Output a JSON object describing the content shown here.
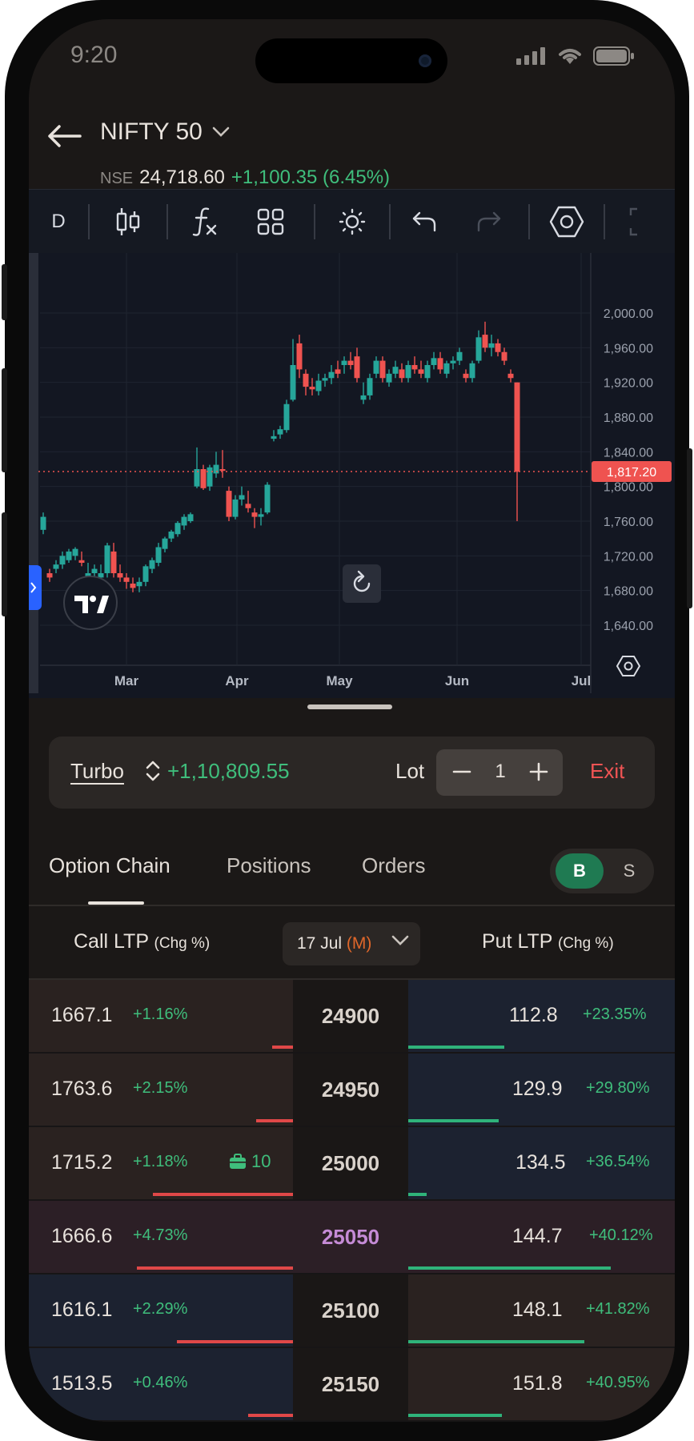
{
  "status": {
    "time": "9:20"
  },
  "header": {
    "title": "NIFTY 50",
    "exchange": "NSE",
    "price": "24,718.60",
    "change": "+1,100.35 (6.45%)"
  },
  "toolbar": {
    "interval": "D"
  },
  "chart_data": {
    "type": "candlestick",
    "x_labels": [
      "Mar",
      "Apr",
      "May",
      "Jun",
      "Jul"
    ],
    "y_labels": [
      "2,000.00",
      "1,960.00",
      "1,920.00",
      "1,880.00",
      "1,840.00",
      "1,800.00",
      "1,760.00",
      "1,720.00",
      "1,680.00",
      "1,640.00"
    ],
    "ylim": [
      1640,
      2000
    ],
    "last_price": 1817.2,
    "last_price_label": "1,817.20",
    "candles": [
      [
        1750,
        1770,
        1745,
        1765
      ],
      [
        1700,
        1705,
        1690,
        1695
      ],
      [
        1705,
        1715,
        1700,
        1710
      ],
      [
        1710,
        1725,
        1705,
        1720
      ],
      [
        1715,
        1728,
        1712,
        1725
      ],
      [
        1720,
        1730,
        1715,
        1728
      ],
      [
        1715,
        1725,
        1708,
        1712
      ],
      [
        1695,
        1712,
        1690,
        1700
      ],
      [
        1700,
        1710,
        1695,
        1705
      ],
      [
        1695,
        1710,
        1690,
        1700
      ],
      [
        1700,
        1735,
        1695,
        1732
      ],
      [
        1725,
        1735,
        1695,
        1700
      ],
      [
        1700,
        1710,
        1690,
        1695
      ],
      [
        1695,
        1700,
        1682,
        1690
      ],
      [
        1688,
        1695,
        1678,
        1683
      ],
      [
        1685,
        1695,
        1678,
        1690
      ],
      [
        1690,
        1710,
        1685,
        1708
      ],
      [
        1705,
        1718,
        1700,
        1715
      ],
      [
        1712,
        1735,
        1708,
        1730
      ],
      [
        1728,
        1742,
        1724,
        1740
      ],
      [
        1740,
        1750,
        1736,
        1748
      ],
      [
        1745,
        1760,
        1742,
        1758
      ],
      [
        1755,
        1768,
        1750,
        1765
      ],
      [
        1760,
        1770,
        1758,
        1768
      ],
      [
        1800,
        1845,
        1798,
        1820
      ],
      [
        1820,
        1825,
        1796,
        1798
      ],
      [
        1800,
        1825,
        1795,
        1822
      ],
      [
        1815,
        1840,
        1810,
        1825
      ],
      [
        1820,
        1842,
        1810,
        1818
      ],
      [
        1795,
        1800,
        1760,
        1765
      ],
      [
        1765,
        1790,
        1762,
        1785
      ],
      [
        1785,
        1800,
        1778,
        1790
      ],
      [
        1780,
        1795,
        1770,
        1775
      ],
      [
        1770,
        1775,
        1752,
        1765
      ],
      [
        1765,
        1775,
        1755,
        1768
      ],
      [
        1770,
        1805,
        1768,
        1802
      ],
      [
        1855,
        1865,
        1852,
        1858
      ],
      [
        1860,
        1870,
        1855,
        1866
      ],
      [
        1865,
        1900,
        1862,
        1895
      ],
      [
        1900,
        1970,
        1898,
        1940
      ],
      [
        1965,
        1975,
        1925,
        1935
      ],
      [
        1930,
        1935,
        1905,
        1915
      ],
      [
        1915,
        1925,
        1905,
        1912
      ],
      [
        1910,
        1930,
        1905,
        1922
      ],
      [
        1922,
        1930,
        1915,
        1925
      ],
      [
        1925,
        1940,
        1918,
        1932
      ],
      [
        1935,
        1945,
        1925,
        1930
      ],
      [
        1940,
        1950,
        1930,
        1945
      ],
      [
        1945,
        1955,
        1935,
        1940
      ],
      [
        1950,
        1960,
        1920,
        1925
      ],
      [
        1900,
        1920,
        1895,
        1905
      ],
      [
        1905,
        1930,
        1900,
        1925
      ],
      [
        1930,
        1950,
        1925,
        1945
      ],
      [
        1945,
        1950,
        1920,
        1925
      ],
      [
        1920,
        1935,
        1915,
        1930
      ],
      [
        1930,
        1945,
        1925,
        1938
      ],
      [
        1935,
        1942,
        1920,
        1925
      ],
      [
        1925,
        1945,
        1920,
        1940
      ],
      [
        1940,
        1950,
        1930,
        1935
      ],
      [
        1935,
        1945,
        1925,
        1930
      ],
      [
        1925,
        1945,
        1920,
        1940
      ],
      [
        1940,
        1955,
        1935,
        1948
      ],
      [
        1948,
        1955,
        1930,
        1935
      ],
      [
        1930,
        1945,
        1925,
        1942
      ],
      [
        1942,
        1950,
        1935,
        1945
      ],
      [
        1945,
        1960,
        1940,
        1955
      ],
      [
        1930,
        1935,
        1920,
        1925
      ],
      [
        1925,
        1945,
        1920,
        1942
      ],
      [
        1945,
        1980,
        1942,
        1972
      ],
      [
        1975,
        1990,
        1955,
        1960
      ],
      [
        1960,
        1975,
        1950,
        1965
      ],
      [
        1965,
        1970,
        1950,
        1955
      ],
      [
        1955,
        1960,
        1940,
        1945
      ],
      [
        1930,
        1935,
        1920,
        1925
      ],
      [
        1920,
        1920,
        1760,
        1817
      ]
    ]
  },
  "turbo": {
    "label": "Turbo",
    "pnl": "+1,10,809.55",
    "lot_label": "Lot",
    "lot_value": "1",
    "exit_label": "Exit"
  },
  "tabs": [
    "Option Chain",
    "Positions",
    "Orders"
  ],
  "bs_toggle": {
    "buy": "B",
    "sell": "S"
  },
  "chain_header": {
    "call": "Call LTP",
    "call_sub": "(Chg %)",
    "put": "Put LTP",
    "put_sub": "(Chg %)",
    "expiry": "17 Jul",
    "expiry_tag": "(M)"
  },
  "rows": [
    {
      "call_ltp": "1667.1",
      "call_chg": "+1.16%",
      "strike": "24900",
      "put_ltp": "112.8",
      "put_chg": "+23.35%",
      "call_bar": 0.08,
      "put_bar": 0.36,
      "position": ""
    },
    {
      "call_ltp": "1763.6",
      "call_chg": "+2.15%",
      "strike": "24950",
      "put_ltp": "129.9",
      "put_chg": "+29.80%",
      "call_bar": 0.14,
      "put_bar": 0.34,
      "position": ""
    },
    {
      "call_ltp": "1715.2",
      "call_chg": "+1.18%",
      "strike": "25000",
      "put_ltp": "134.5",
      "put_chg": "+36.54%",
      "call_bar": 0.53,
      "put_bar": 0.07,
      "position": "10"
    },
    {
      "call_ltp": "1666.6",
      "call_chg": "+4.73%",
      "strike": "25050",
      "put_ltp": "144.7",
      "put_chg": "+40.12%",
      "call_bar": 0.59,
      "put_bar": 0.76,
      "position": ""
    },
    {
      "call_ltp": "1616.1",
      "call_chg": "+2.29%",
      "strike": "25100",
      "put_ltp": "148.1",
      "put_chg": "+41.82%",
      "call_bar": 0.44,
      "put_bar": 0.66,
      "position": ""
    },
    {
      "call_ltp": "1513.5",
      "call_chg": "+0.46%",
      "strike": "25150",
      "put_ltp": "151.8",
      "put_chg": "+40.95%",
      "call_bar": 0.17,
      "put_bar": 0.35,
      "position": ""
    }
  ],
  "colors": {
    "up": "#26a69a",
    "down": "#ef5350",
    "positive_text": "#3fbe7c",
    "exit": "#f05454",
    "atm_strike": "#c58bd6"
  }
}
